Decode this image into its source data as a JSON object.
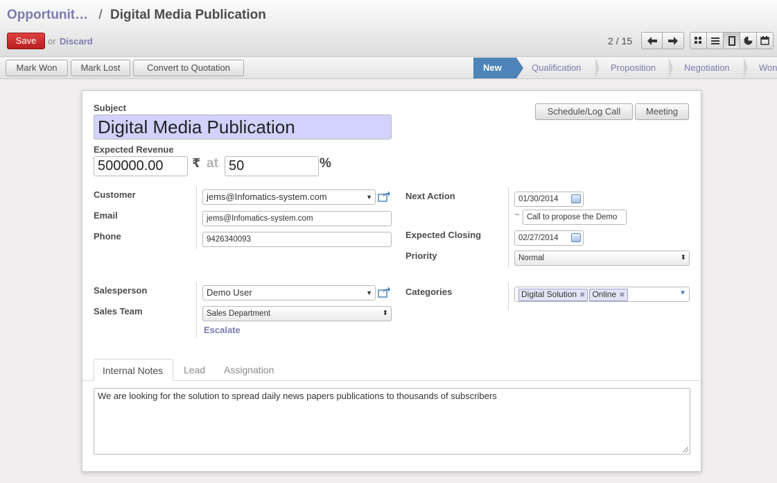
{
  "breadcrumb": {
    "parent": "Opportunit…",
    "separator": "/",
    "current": "Digital Media Publication"
  },
  "actions": {
    "save_label": "Save",
    "or_label": "or",
    "discard_label": "Discard"
  },
  "pager": {
    "text": "2 / 15",
    "prev_icon": "arrow-left-icon",
    "next_icon": "arrow-right-icon"
  },
  "views": [
    {
      "name": "kanban-view-icon"
    },
    {
      "name": "list-view-icon"
    },
    {
      "name": "form-view-icon",
      "active": true
    },
    {
      "name": "graph-view-icon"
    },
    {
      "name": "calendar-view-icon"
    }
  ],
  "header_buttons": {
    "mark_won": "Mark Won",
    "mark_lost": "Mark Lost",
    "convert": "Convert to Quotation"
  },
  "stages": [
    "New",
    "Qualification",
    "Proposition",
    "Negotiation",
    "Won"
  ],
  "active_stage": "New",
  "form": {
    "subject_label": "Subject",
    "subject_value": "Digital Media Publication",
    "expected_revenue_label": "Expected Revenue",
    "revenue_value": "500000.00",
    "currency_symbol": "₹",
    "at_label": "at",
    "probability_value": "50",
    "percent_symbol": "%",
    "schedule_call_label": "Schedule/Log Call",
    "meeting_label": "Meeting",
    "customer_label": "Customer",
    "customer_value": "jems@Infomatics-system.com",
    "email_label": "Email",
    "email_value": "jems@Infomatics-system.com",
    "phone_label": "Phone",
    "phone_value": "9426340093",
    "next_action_label": "Next Action",
    "next_action_date": "01/30/2014",
    "next_action_dash": "–",
    "next_action_text": "Call to propose the Demo",
    "expected_closing_label": "Expected Closing",
    "expected_closing_date": "02/27/2014",
    "priority_label": "Priority",
    "priority_value": "Normal",
    "salesperson_label": "Salesperson",
    "salesperson_value": "Demo User",
    "sales_team_label": "Sales Team",
    "sales_team_value": "Sales Department",
    "escalate_label": "Escalate",
    "categories_label": "Categories",
    "categories": [
      "Digital Solution",
      "Online"
    ]
  },
  "tabs": [
    "Internal Notes",
    "Lead",
    "Assignation"
  ],
  "notes_text": "We are looking for the solution to spread daily news papers publications to thousands of subscribers",
  "colors": {
    "accent": "#7c7bad",
    "save": "#d42b2b",
    "stage_active": "#4e84b9",
    "required_field": "#d2d2ff"
  }
}
